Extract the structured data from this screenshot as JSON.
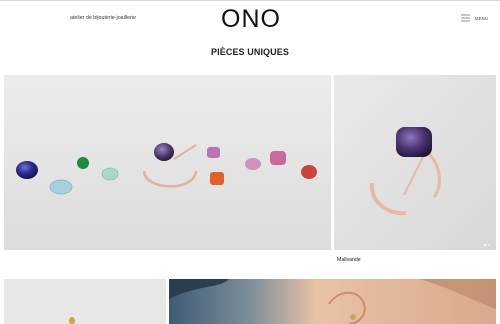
{
  "header": {
    "tagline": "atelier de bijouterie-joaillerie",
    "logo": "ONO",
    "menu_label": "MENU",
    "menu_icon": "hamburger-menu-icon"
  },
  "page": {
    "title": "PIÈCES UNIQUES"
  },
  "products": [
    {
      "caption": ""
    },
    {
      "caption": "Mallsande"
    },
    {
      "caption": ""
    },
    {
      "caption": ""
    }
  ],
  "carousel": {
    "dot_count": 2,
    "active_index": 0
  },
  "colors": {
    "accent_gold": "#e2b39c",
    "sapphire": "#2d2e8a",
    "emerald": "#1f8a3c",
    "mauve_stone": "#5a3e73",
    "background_grey": "#e4e4e4"
  }
}
